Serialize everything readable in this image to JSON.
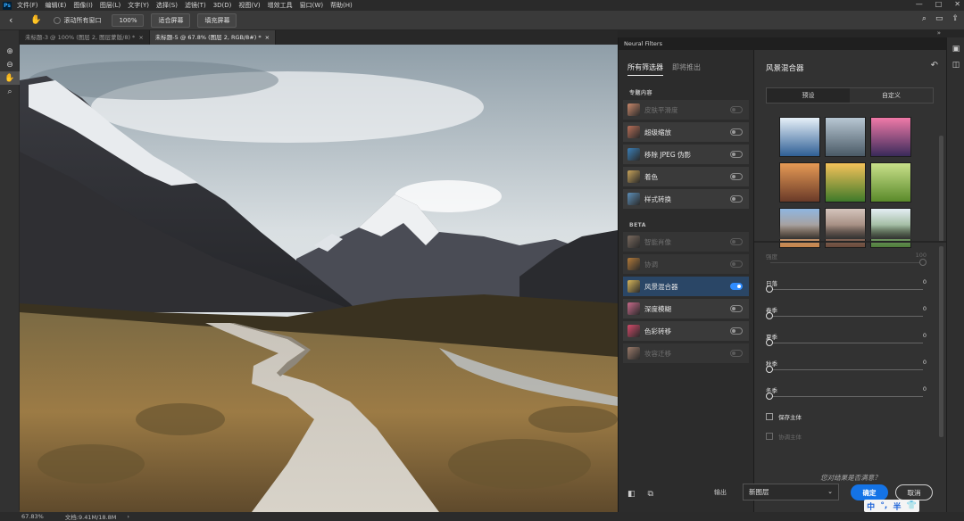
{
  "menubar": {
    "logo": "Ps",
    "items": [
      "文件(F)",
      "编辑(E)",
      "图像(I)",
      "图层(L)",
      "文字(Y)",
      "选择(S)",
      "滤镜(T)",
      "3D(D)",
      "视图(V)",
      "增效工具",
      "窗口(W)",
      "帮助(H)"
    ],
    "minimize": "—",
    "maximize": "□",
    "close": "✕"
  },
  "optbar": {
    "scroll_all_label": "滚动所有窗口",
    "zoom_button": "100%",
    "fit_button": "适合屏幕",
    "fill_button": "填充屏幕"
  },
  "tabs": [
    {
      "label": "未标题-3 @ 100% (图层 2, 图层蒙版/8) *",
      "active": false
    },
    {
      "label": "未标题-5 @ 67.8% (图层 2, RGB/8#) *",
      "active": true
    }
  ],
  "statusbar": {
    "zoom": "67.83%",
    "doc_info": "文档:9.41M/18.8M",
    "arrow": "›"
  },
  "neural_filters": {
    "panel_title": "Neural Filters",
    "collapse": "»",
    "tabs": [
      {
        "label": "所有筛选器",
        "active": true
      },
      {
        "label": "即将推出",
        "active": false
      }
    ],
    "featured_heading": "专题内容",
    "featured": [
      {
        "label": "皮肤平滑度",
        "disabled": true,
        "on": false,
        "color": "#c9886b"
      },
      {
        "label": "超级缩放",
        "disabled": false,
        "on": false,
        "color": "#b86f58"
      },
      {
        "label": "移除 JPEG 伪影",
        "disabled": false,
        "on": false,
        "color": "#3b7fb7"
      },
      {
        "label": "着色",
        "disabled": false,
        "on": false,
        "color": "#c7a35a"
      },
      {
        "label": "样式转换",
        "disabled": false,
        "on": false,
        "color": "#5d8fb8"
      }
    ],
    "beta_heading": "BETA",
    "beta": [
      {
        "label": "智能肖像",
        "disabled": true,
        "on": false,
        "color": "#7a6a5e"
      },
      {
        "label": "协调",
        "disabled": true,
        "on": false,
        "color": "#b27a3a"
      },
      {
        "label": "风景混合器",
        "disabled": false,
        "on": true,
        "selected": true,
        "color": "#d8b65a"
      },
      {
        "label": "深度模糊",
        "disabled": false,
        "on": false,
        "color": "#c86a8a"
      },
      {
        "label": "色彩转移",
        "disabled": false,
        "on": false,
        "color": "#d44a6a"
      },
      {
        "label": "妆容迁移",
        "disabled": true,
        "on": false,
        "color": "#9a7a6a"
      }
    ],
    "detail": {
      "title": "风景混合器",
      "reset": "↶",
      "seg_tabs": [
        {
          "label": "预设",
          "active": true
        },
        {
          "label": "自定义",
          "active": false
        }
      ],
      "presets": [
        {
          "from": "#e7f0f8",
          "to": "#2f5f95"
        },
        {
          "from": "#b8c7d3",
          "to": "#4a5a66"
        },
        {
          "from": "#f07aa8",
          "to": "#3a2a5a"
        },
        {
          "from": "#e69a55",
          "to": "#6a3a28"
        },
        {
          "from": "#f5c25a",
          "to": "#3f7a2a"
        },
        {
          "from": "#c9e08a",
          "to": "#5a8a2a"
        },
        {
          "from": "#8fb6e0",
          "to": "#c8864a"
        },
        {
          "from": "#d4c4bc",
          "to": "#6a4a3a"
        },
        {
          "from": "#e4eef4",
          "to": "#4f7d3a"
        }
      ],
      "sliders": [
        {
          "label": "强度",
          "value": "100",
          "pos": 1.0,
          "disabled": true
        },
        {
          "label": "日落",
          "value": "0",
          "pos": 0.0,
          "disabled": false
        },
        {
          "label": "春季",
          "value": "0",
          "pos": 0.0,
          "disabled": false
        },
        {
          "label": "夏季",
          "value": "0",
          "pos": 0.0,
          "disabled": false
        },
        {
          "label": "秋季",
          "value": "0",
          "pos": 0.0,
          "disabled": false
        },
        {
          "label": "冬季",
          "value": "0",
          "pos": 0.0,
          "disabled": false
        }
      ],
      "checks": [
        {
          "label": "保存主体",
          "disabled": false
        },
        {
          "label": "协调主体",
          "disabled": true
        }
      ],
      "feedback": "您对结果是否满意？"
    },
    "output_label": "输出",
    "output_value": "新图层",
    "ok": "确定",
    "cancel": "取消"
  },
  "ime": {
    "a": "中",
    "b": "°,",
    "c": "半",
    "d": "👕"
  }
}
